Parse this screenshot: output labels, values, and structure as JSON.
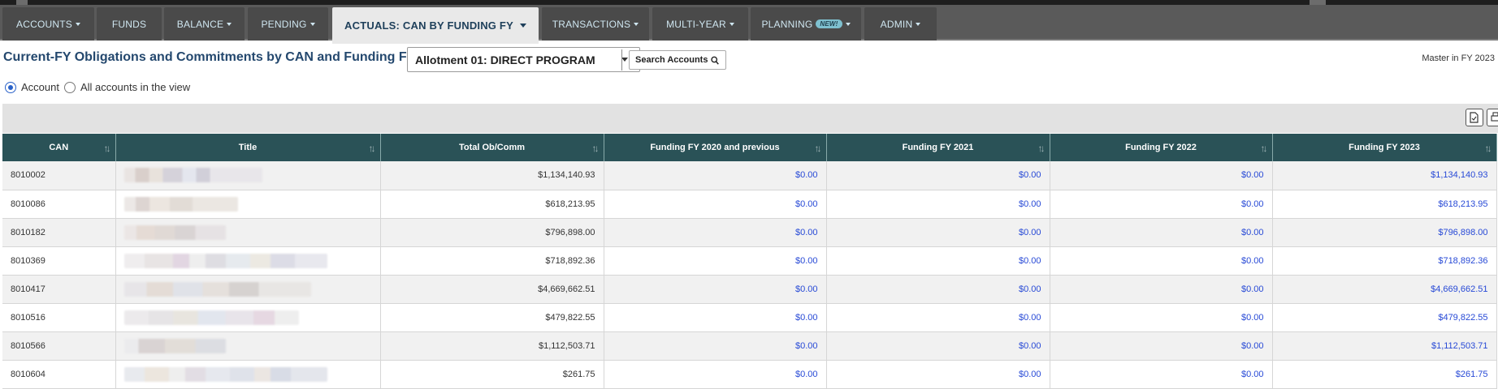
{
  "nav": {
    "tabs": [
      {
        "label": "ACCOUNTS",
        "dropdown": true
      },
      {
        "label": "FUNDS",
        "dropdown": false
      },
      {
        "label": "BALANCE",
        "dropdown": true
      },
      {
        "label": "PENDING",
        "dropdown": true
      },
      {
        "label": "ACTUALS: CAN BY FUNDING FY",
        "dropdown": true,
        "active": true
      },
      {
        "label": "TRANSACTIONS",
        "dropdown": true
      },
      {
        "label": "MULTI-YEAR",
        "dropdown": true
      },
      {
        "label": "PLANNING",
        "dropdown": true,
        "badge": "NEW!"
      },
      {
        "label": "ADMIN",
        "dropdown": true
      }
    ]
  },
  "header": {
    "title": "Current-FY Obligations and Commitments by CAN and Funding FY",
    "allotment": "Allotment 01: DIRECT PROGRAM",
    "search_label": "Search Accounts",
    "master_text": "Master in FY 2023"
  },
  "scope": {
    "option_account": "Account",
    "option_all": "All accounts in the view",
    "selected": "Account"
  },
  "toolbar": {
    "icons": [
      "export-icon",
      "print-icon"
    ]
  },
  "table": {
    "columns": [
      "CAN",
      "Title",
      "Total Ob/Comm",
      "Funding FY 2020 and previous",
      "Funding FY 2021",
      "Funding FY 2022",
      "Funding FY 2023"
    ],
    "rows": [
      {
        "can": "8010002",
        "total": "$1,134,140.93",
        "fy2020": "$0.00",
        "fy2021": "$0.00",
        "fy2022": "$0.00",
        "fy2023": "$1,134,140.93"
      },
      {
        "can": "8010086",
        "total": "$618,213.95",
        "fy2020": "$0.00",
        "fy2021": "$0.00",
        "fy2022": "$0.00",
        "fy2023": "$618,213.95"
      },
      {
        "can": "8010182",
        "total": "$796,898.00",
        "fy2020": "$0.00",
        "fy2021": "$0.00",
        "fy2022": "$0.00",
        "fy2023": "$796,898.00"
      },
      {
        "can": "8010369",
        "total": "$718,892.36",
        "fy2020": "$0.00",
        "fy2021": "$0.00",
        "fy2022": "$0.00",
        "fy2023": "$718,892.36"
      },
      {
        "can": "8010417",
        "total": "$4,669,662.51",
        "fy2020": "$0.00",
        "fy2021": "$0.00",
        "fy2022": "$0.00",
        "fy2023": "$4,669,662.51"
      },
      {
        "can": "8010516",
        "total": "$479,822.55",
        "fy2020": "$0.00",
        "fy2021": "$0.00",
        "fy2022": "$0.00",
        "fy2023": "$479,822.55"
      },
      {
        "can": "8010566",
        "total": "$1,112,503.71",
        "fy2020": "$0.00",
        "fy2021": "$0.00",
        "fy2022": "$0.00",
        "fy2023": "$1,112,503.71"
      },
      {
        "can": "8010604",
        "total": "$261.75",
        "fy2020": "$0.00",
        "fy2021": "$0.00",
        "fy2022": "$0.00",
        "fy2023": "$261.75"
      }
    ]
  },
  "colors": {
    "nav_bg": "#5a5a5a",
    "tab_bg": "#4a4a4a",
    "header_bg": "#2a5257",
    "title_color": "#24486e",
    "amount_link": "#2749d6"
  }
}
